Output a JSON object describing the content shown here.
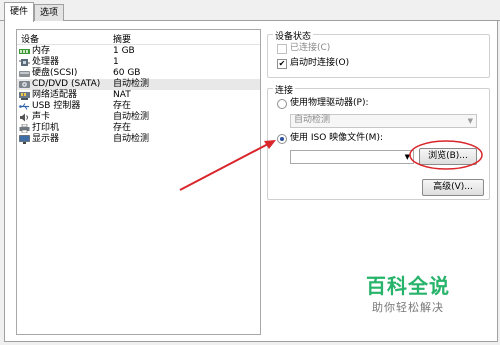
{
  "tabs": [
    {
      "label": "硬件"
    },
    {
      "label": "选项"
    }
  ],
  "device_list": {
    "headers": {
      "device": "设备",
      "summary": "摘要"
    },
    "rows": [
      {
        "name": "内存",
        "summary": "1 GB",
        "icon": "memory-icon"
      },
      {
        "name": "处理器",
        "summary": "1",
        "icon": "cpu-icon"
      },
      {
        "name": "硬盘(SCSI)",
        "summary": "60 GB",
        "icon": "harddisk-icon"
      },
      {
        "name": "CD/DVD (SATA)",
        "summary": "自动检测",
        "icon": "cd-dvd-icon",
        "selected": true
      },
      {
        "name": "网络适配器",
        "summary": "NAT",
        "icon": "network-icon"
      },
      {
        "name": "USB 控制器",
        "summary": "存在",
        "icon": "usb-icon"
      },
      {
        "name": "声卡",
        "summary": "自动检测",
        "icon": "sound-icon"
      },
      {
        "name": "打印机",
        "summary": "存在",
        "icon": "printer-icon"
      },
      {
        "name": "显示器",
        "summary": "自动检测",
        "icon": "display-icon"
      }
    ]
  },
  "device_status": {
    "title": "设备状态",
    "connected": {
      "label": "已连接(C)",
      "checked": false,
      "disabled": true
    },
    "connect_on_power_on": {
      "label": "启动时连接(O)",
      "checked": true
    }
  },
  "connection": {
    "title": "连接",
    "physical": {
      "label": "使用物理驱动器(P):",
      "selected": false,
      "combo_value": "自动检测"
    },
    "iso": {
      "label": "使用 ISO 映像文件(M):",
      "selected": true,
      "path_value": ""
    },
    "browse_label": "浏览(B)...",
    "advanced_label": "高级(V)..."
  },
  "watermark": {
    "line1": "百科全说",
    "line2": "助你轻松解决"
  },
  "colors": {
    "annotation": "#d9262b",
    "watermark_green": "#27b36a"
  }
}
